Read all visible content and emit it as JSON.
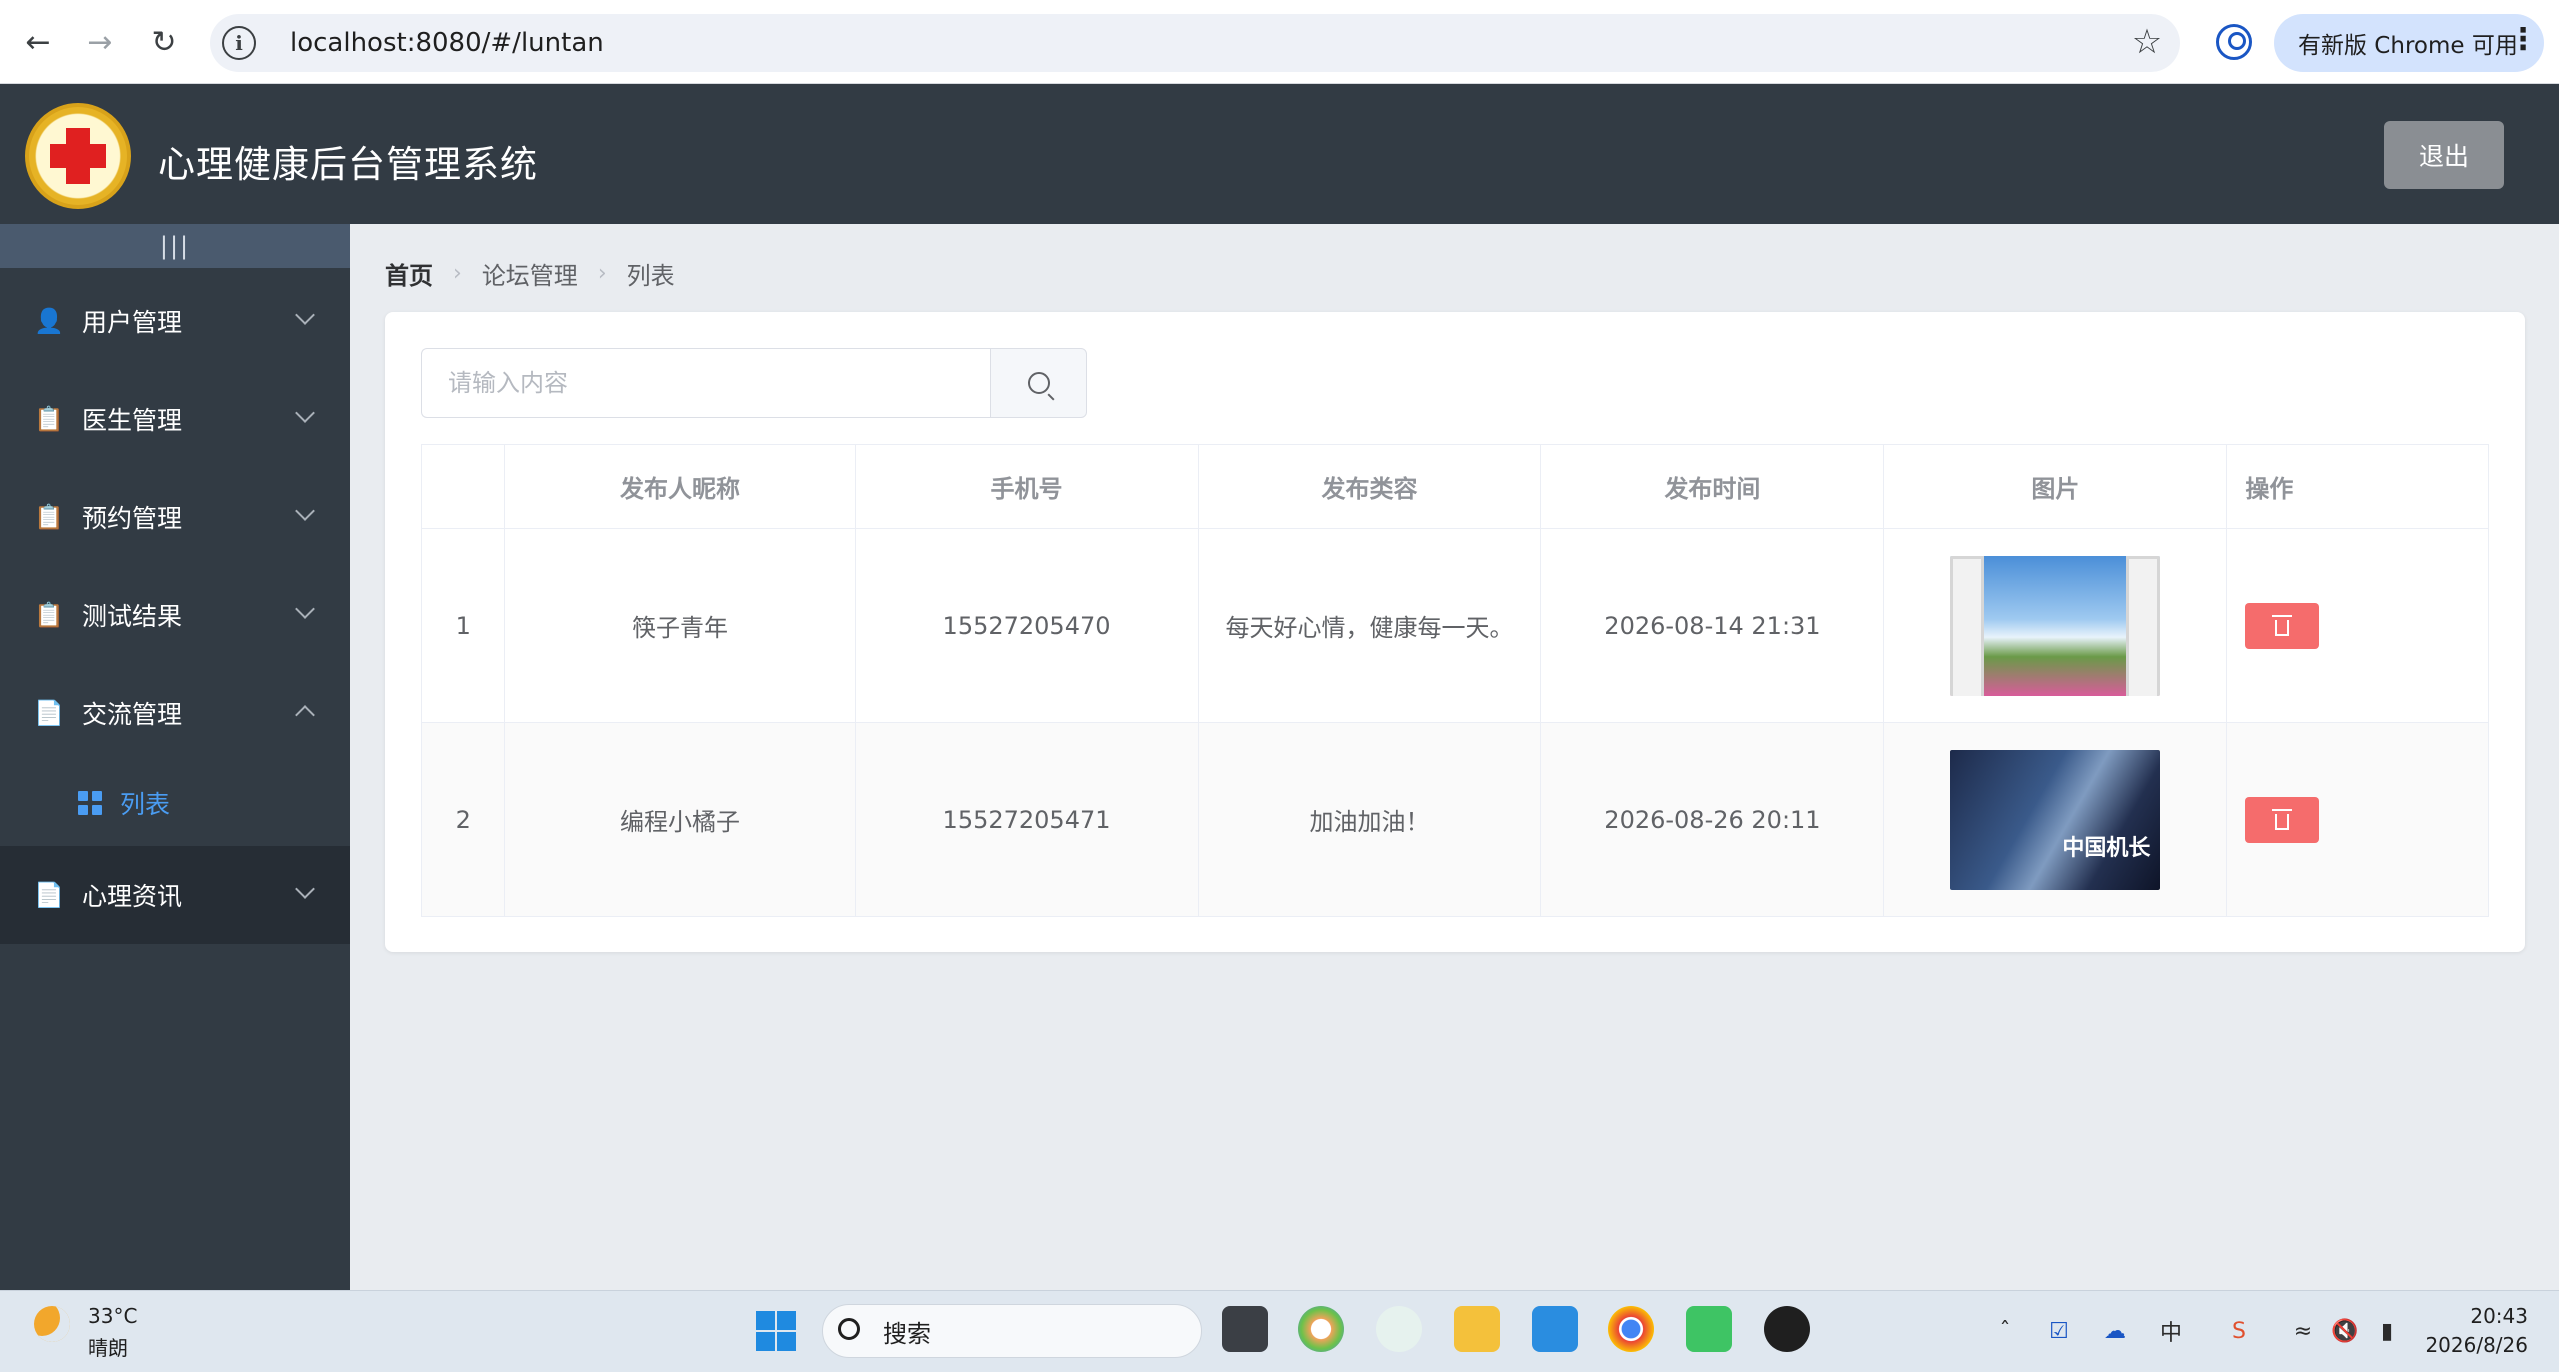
{
  "browser": {
    "url": "localhost:8080/#/luntan",
    "update_label": "有新版 Chrome 可用"
  },
  "header": {
    "title": "心理健康后台管理系统",
    "logout_label": "退出"
  },
  "sidebar": {
    "toggle": "|||",
    "items": [
      {
        "label": "用户管理",
        "icon": "user-icon"
      },
      {
        "label": "医生管理",
        "icon": "clipboard-icon"
      },
      {
        "label": "预约管理",
        "icon": "clipboard-icon"
      },
      {
        "label": "测试结果",
        "icon": "clipboard-icon"
      },
      {
        "label": "交流管理",
        "icon": "document-icon",
        "expanded": true
      },
      {
        "label": "心理资讯",
        "icon": "document-icon"
      }
    ],
    "submenu": {
      "label": "列表",
      "icon": "grid-icon",
      "active_color": "#4a9cf2"
    }
  },
  "breadcrumb": [
    "首页",
    "论坛管理",
    "列表"
  ],
  "search": {
    "placeholder": "请输入内容",
    "value": ""
  },
  "table": {
    "headers": [
      "",
      "发布人昵称",
      "手机号",
      "发布类容",
      "发布时间",
      "图片",
      "操作"
    ],
    "rows": [
      {
        "index": "1",
        "nickname": "筷子青年",
        "phone": "15527205470",
        "content": "每天好心情，健康每一天。",
        "time": "2026-08-14 21:31",
        "image": "window-flowers-image"
      },
      {
        "index": "2",
        "nickname": "编程小橘子",
        "phone": "15527205471",
        "content": "加油加油！",
        "time": "2026-08-26 20:11",
        "image": "movie-poster-image",
        "poster_text": "中国机长"
      }
    ]
  },
  "taskbar": {
    "weather_temp": "33°C",
    "weather_desc": "晴朗",
    "search_label": "搜索",
    "time": "20:43",
    "date": "2026/8/26"
  },
  "colors": {
    "header_bg": "#323b44",
    "delete_button": "#f56c6c",
    "accent": "#4a9cf2"
  }
}
